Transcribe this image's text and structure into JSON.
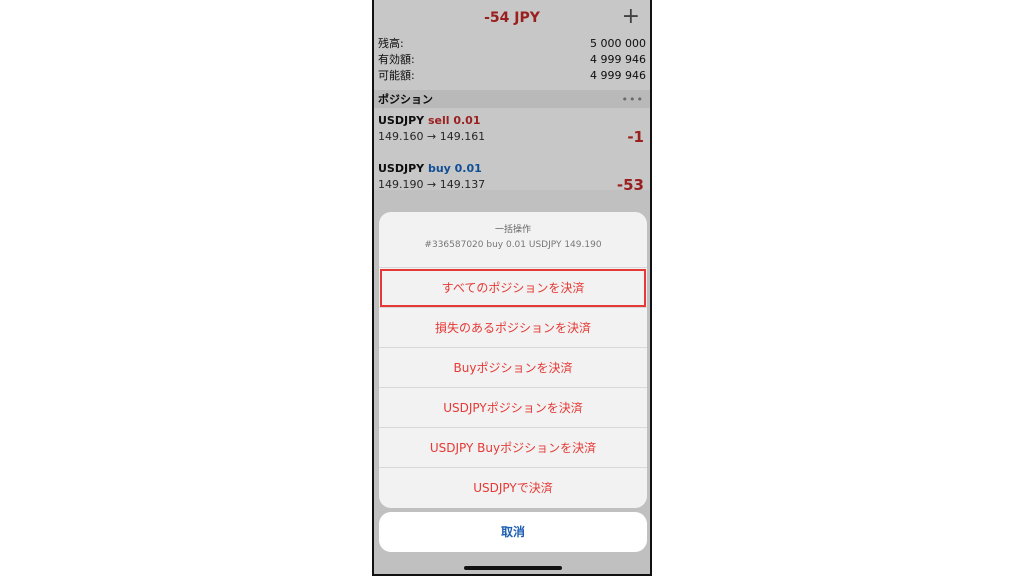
{
  "header": {
    "title": "-54 JPY",
    "plus_icon": "+"
  },
  "account": {
    "rows": [
      {
        "label": "残高:",
        "value": "5 000 000"
      },
      {
        "label": "有効額:",
        "value": "4 999 946"
      },
      {
        "label": "可能額:",
        "value": "4 999 946"
      }
    ]
  },
  "positions": {
    "section_label": "ポジション",
    "more_icon": "•••",
    "items": [
      {
        "symbol": "USDJPY",
        "side": "sell 0.01",
        "prices": "149.160 → 149.161",
        "pl": "-1"
      },
      {
        "symbol": "USDJPY",
        "side": "buy 0.01",
        "prices": "149.190 → 149.137",
        "pl": "-53"
      }
    ]
  },
  "sheet": {
    "title": "一括操作",
    "subtitle": "#336587020 buy 0.01 USDJPY 149.190",
    "actions": [
      "すべてのポジションを決済",
      "損失のあるポジションを決済",
      "Buyポジションを決済",
      "USDJPYポジションを決済",
      "USDJPY Buyポジションを決済",
      "USDJPYで決済"
    ],
    "cancel": "取消"
  },
  "colors": {
    "loss": "#c62828",
    "buy": "#1565c0",
    "action": "#e53935",
    "cancel": "#1e5fb3"
  }
}
